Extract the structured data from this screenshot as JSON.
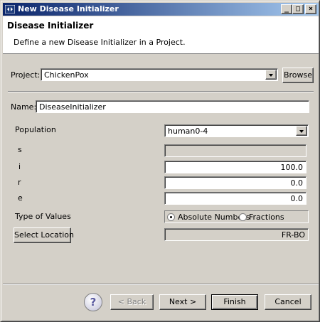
{
  "window": {
    "title": "New Disease Initializer",
    "minimize_glyph": "_",
    "maximize_glyph": "□",
    "close_glyph": "×"
  },
  "banner": {
    "heading": "Disease Initializer",
    "description": "Define a new Disease Initializer in a Project."
  },
  "project": {
    "label": "Project:",
    "value": "ChickenPox",
    "browse_label": "Browse"
  },
  "name": {
    "label": "Name:",
    "value": "DiseaseInitializer"
  },
  "population": {
    "label": "Population",
    "value": "human0-4"
  },
  "compartments": [
    {
      "label": "s",
      "value": "",
      "enabled": false
    },
    {
      "label": "i",
      "value": "100.0",
      "enabled": true
    },
    {
      "label": "r",
      "value": "0.0",
      "enabled": true
    },
    {
      "label": "e",
      "value": "0.0",
      "enabled": true
    }
  ],
  "value_type": {
    "label": "Type of Values",
    "options": [
      "Absolute Numbers",
      "Fractions"
    ],
    "selected": "Absolute Numbers"
  },
  "location": {
    "button_label": "Select Location",
    "value": "FR-BO"
  },
  "footer": {
    "help_glyph": "?",
    "back_label": "< Back",
    "next_label": "Next >",
    "finish_label": "Finish",
    "cancel_label": "Cancel"
  }
}
